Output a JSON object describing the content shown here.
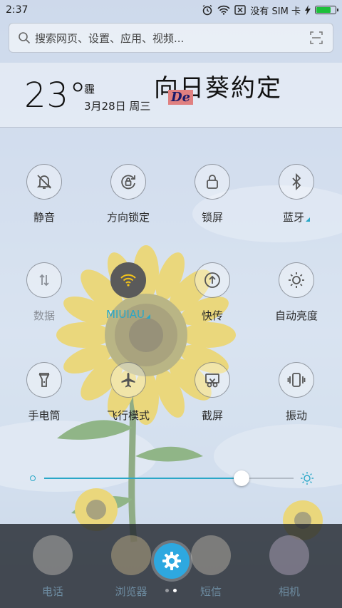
{
  "status_bar": {
    "time": "2:37",
    "carrier": "没有 SIM 卡",
    "battery_level": 0.85
  },
  "search": {
    "placeholder": "搜索网页、设置、应用、视频..."
  },
  "weather": {
    "temperature": "23°",
    "condition": "霾",
    "date": "3月28日 周三",
    "brand_text": "向日葵約定",
    "brand_badge": "De"
  },
  "toggles": [
    {
      "label": "静音",
      "icon": "bell-off-icon",
      "active": false,
      "state": "normal"
    },
    {
      "label": "方向锁定",
      "icon": "rotation-lock-icon",
      "active": false,
      "state": "normal"
    },
    {
      "label": "锁屏",
      "icon": "lock-icon",
      "active": false,
      "state": "normal"
    },
    {
      "label": "蓝牙",
      "icon": "bluetooth-icon",
      "active": false,
      "state": "normal",
      "has_more": true
    },
    {
      "label": "数据",
      "icon": "mobile-data-icon",
      "active": false,
      "state": "dim"
    },
    {
      "label": "MIUIAU",
      "icon": "wifi-icon",
      "active": true,
      "state": "accent",
      "has_more": true
    },
    {
      "label": "快传",
      "icon": "upload-icon",
      "active": false,
      "state": "normal"
    },
    {
      "label": "自动亮度",
      "icon": "auto-brightness-icon",
      "active": false,
      "state": "normal"
    },
    {
      "label": "手电筒",
      "icon": "flashlight-icon",
      "active": false,
      "state": "normal"
    },
    {
      "label": "飞行模式",
      "icon": "airplane-icon",
      "active": false,
      "state": "normal"
    },
    {
      "label": "截屏",
      "icon": "screenshot-icon",
      "active": false,
      "state": "normal"
    },
    {
      "label": "振动",
      "icon": "vibrate-icon",
      "active": false,
      "state": "normal"
    }
  ],
  "brightness": {
    "level": 0.79
  },
  "dock": {
    "apps": [
      {
        "label": "电话",
        "icon": "phone-app-icon"
      },
      {
        "label": "浏览器",
        "icon": "browser-app-icon"
      },
      {
        "label": "短信",
        "icon": "messages-app-icon"
      },
      {
        "label": "相机",
        "icon": "camera-app-icon"
      }
    ],
    "page_count": 2,
    "current_page": 2
  },
  "colors": {
    "accent": "#2aa7c7",
    "settings_button": "#2ea8e0",
    "active_toggle": "#5a5a5a"
  }
}
